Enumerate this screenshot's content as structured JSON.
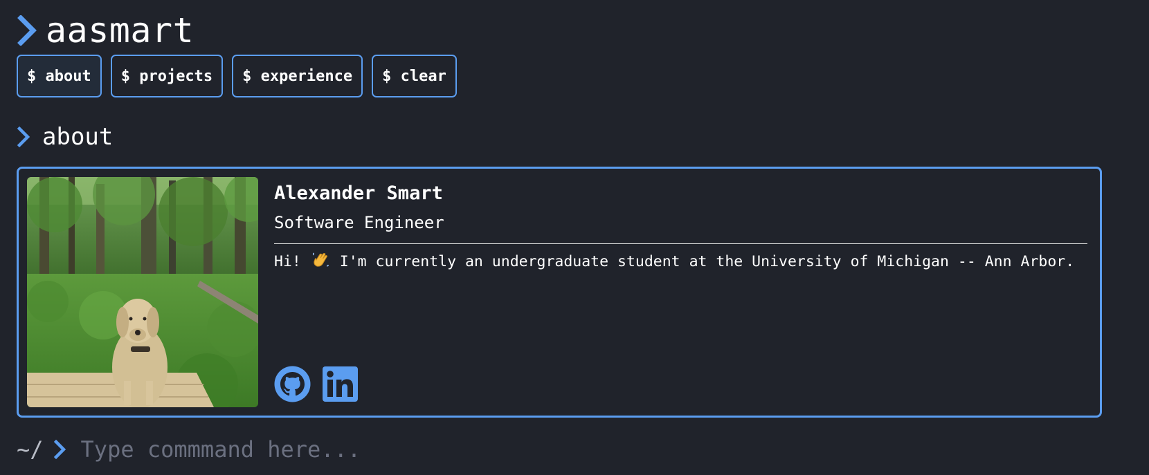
{
  "header": {
    "title": "aasmart"
  },
  "commands": [
    {
      "label": "$ about"
    },
    {
      "label": "$ projects"
    },
    {
      "label": "$ experience"
    },
    {
      "label": "$ clear"
    }
  ],
  "section": {
    "title": "about"
  },
  "profile": {
    "name": "Alexander Smart",
    "role": "Software Engineer",
    "bio_before": "Hi!",
    "bio_after": "I'm currently an undergraduate student at the University of Michigan -- Ann Arbor.",
    "photo_icon": "dog-in-forest-photo",
    "social": [
      {
        "icon": "github-icon"
      },
      {
        "icon": "linkedin-icon"
      }
    ]
  },
  "prompt": {
    "path": "~/",
    "placeholder": "Type commmand here..."
  },
  "colors": {
    "background": "#20232b",
    "accent": "#5b9df0",
    "text": "#ffffff",
    "placeholder": "#6b7080"
  }
}
